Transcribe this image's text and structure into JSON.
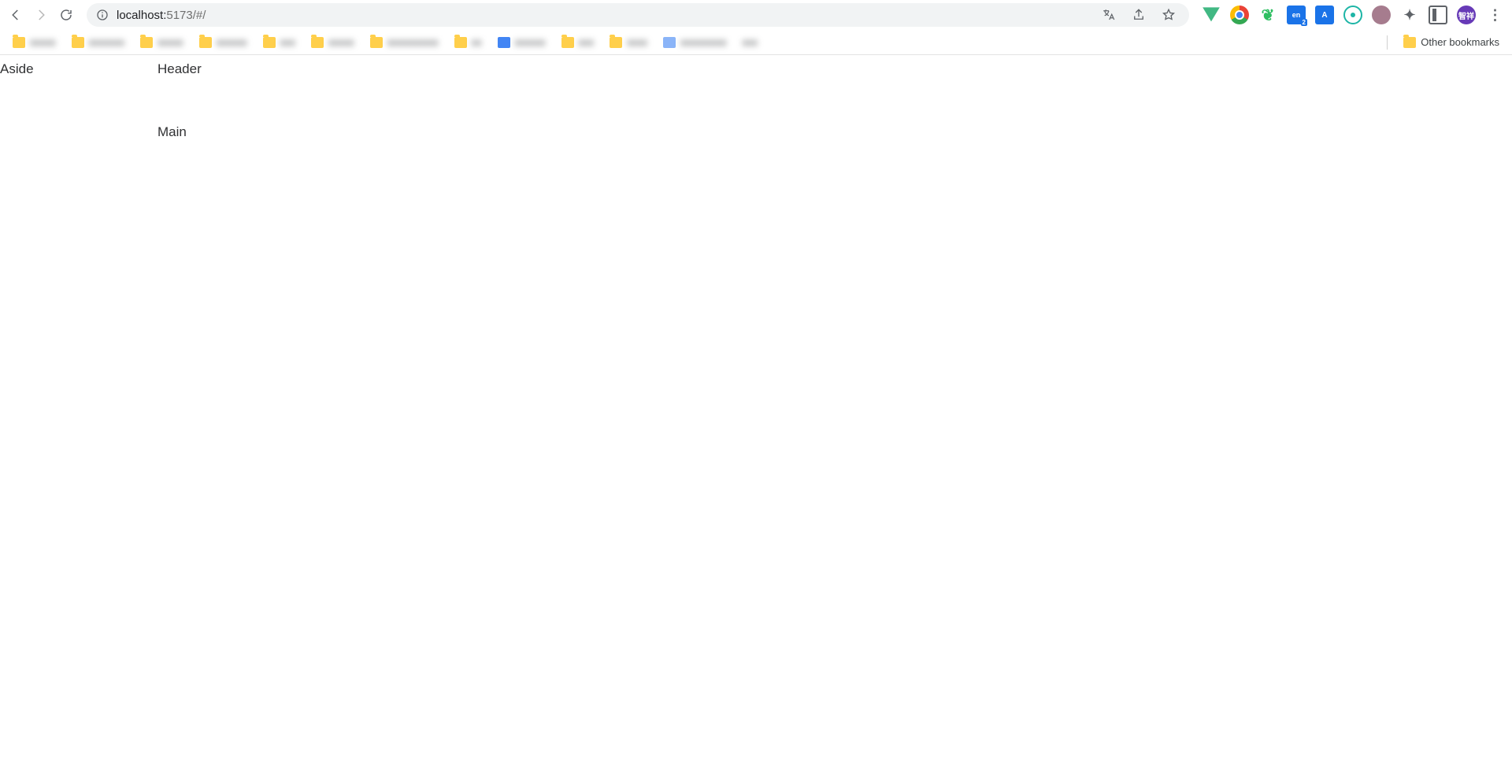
{
  "browser": {
    "url_host": "localhost:",
    "url_port_path": "5173/#/",
    "other_bookmarks_label": "Other bookmarks",
    "avatar_text": "智祥",
    "ext_a_text": "A",
    "ext_lang_text": "en"
  },
  "page": {
    "aside_label": "Aside",
    "header_label": "Header",
    "main_label": "Main"
  }
}
